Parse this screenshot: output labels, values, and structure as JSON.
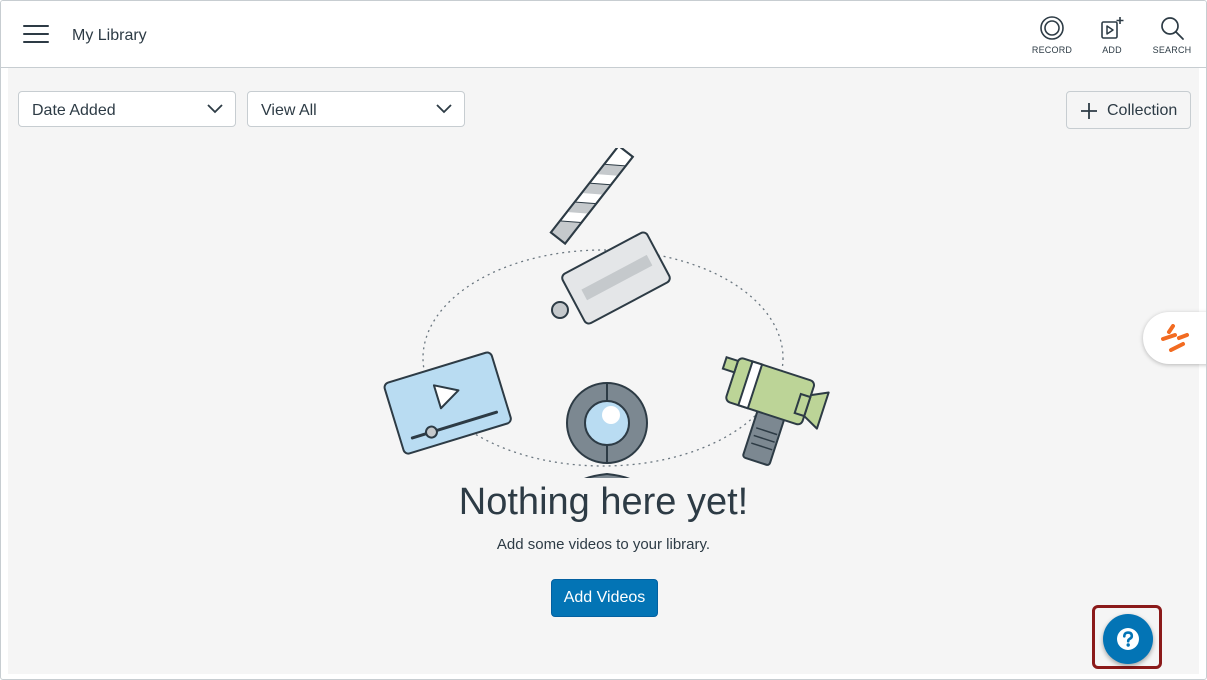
{
  "header": {
    "title": "My Library",
    "menu_icon": "hamburger-menu-icon",
    "tools": [
      {
        "label": "RECORD",
        "icon": "record-icon"
      },
      {
        "label": "ADD",
        "icon": "add-media-icon"
      },
      {
        "label": "SEARCH",
        "icon": "search-icon"
      }
    ]
  },
  "filters": {
    "sort": {
      "selected": "Date Added"
    },
    "view": {
      "selected": "View All"
    }
  },
  "collection_button": {
    "label": "Collection",
    "icon": "plus-icon"
  },
  "empty_state": {
    "title": "Nothing here yet!",
    "subtitle": "Add some videos to your library.",
    "button": "Add Videos",
    "illustration_icons": [
      "clapperboard-icon",
      "video-player-icon",
      "camcorder-icon",
      "webcam-icon"
    ]
  },
  "side_tab": {
    "icon": "extension-logo-icon"
  },
  "help": {
    "icon": "help-question-icon"
  },
  "colors": {
    "primary": "#0374b5",
    "text": "#2d3b45",
    "background": "#f5f5f5",
    "highlight": "#8b1a1a",
    "accent_orange": "#f26b21"
  }
}
